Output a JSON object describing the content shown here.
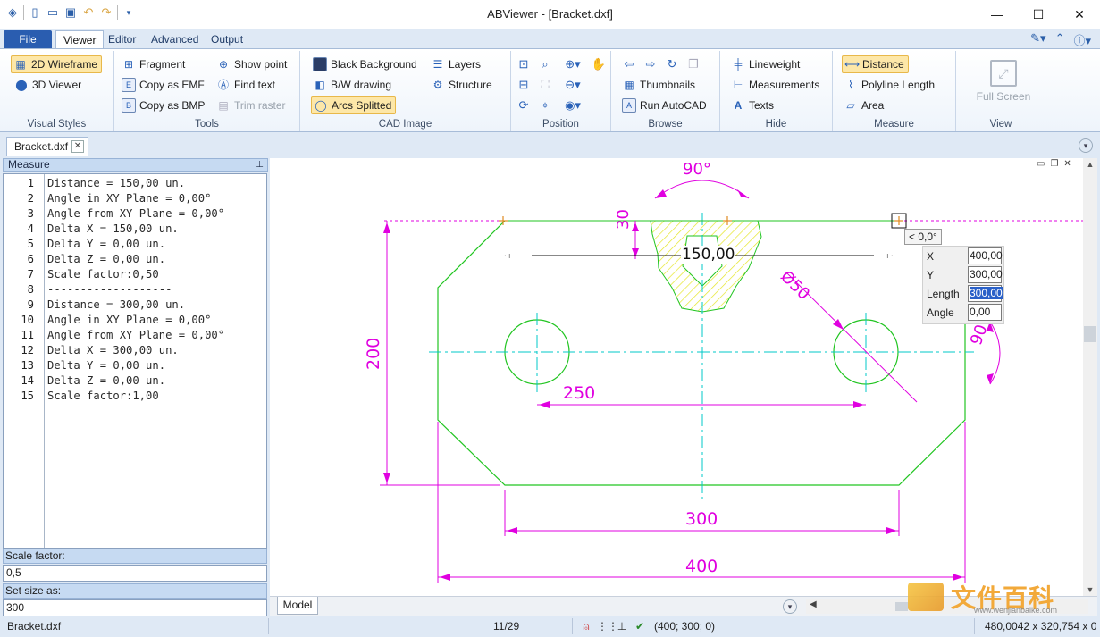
{
  "window": {
    "title": "ABViewer - [Bracket.dxf]",
    "minimize_icon": "minimize-icon",
    "maximize_icon": "maximize-icon",
    "close_icon": "close-icon"
  },
  "tabs": [
    "File",
    "Viewer",
    "Editor",
    "Advanced",
    "Output"
  ],
  "ribbon": {
    "visual_styles": {
      "label": "Visual Styles",
      "wireframe": "2D Wireframe",
      "viewer3d": "3D Viewer"
    },
    "tools": {
      "label": "Tools",
      "fragment": "Fragment",
      "copy_emf": "Copy as EMF",
      "copy_bmp": "Copy as BMP",
      "show_point": "Show point",
      "find_text": "Find text",
      "trim_raster": "Trim raster"
    },
    "cad_image": {
      "label": "CAD Image",
      "black_bg": "Black Background",
      "bw": "B/W drawing",
      "arcs": "Arcs Splitted",
      "layers": "Layers",
      "structure": "Structure"
    },
    "position": {
      "label": "Position"
    },
    "browse": {
      "label": "Browse",
      "thumbnails": "Thumbnails",
      "run_autocad": "Run AutoCAD"
    },
    "hide": {
      "label": "Hide",
      "lineweight": "Lineweight",
      "measurements": "Measurements",
      "texts": "Texts"
    },
    "measure": {
      "label": "Measure",
      "distance": "Distance",
      "polyline": "Polyline Length",
      "area": "Area"
    },
    "view": {
      "label": "View",
      "fullscreen": "Full Screen"
    }
  },
  "doc_tab": "Bracket.dxf",
  "panel": {
    "title": "Measure",
    "lines": [
      {
        "n": "1",
        "text": "Distance = 150,00 un."
      },
      {
        "n": "2",
        "text": "Angle in XY Plane = 0,00°"
      },
      {
        "n": "3",
        "text": "Angle from XY Plane = 0,00°"
      },
      {
        "n": "4",
        "text": "Delta X = 150,00 un."
      },
      {
        "n": "5",
        "text": "Delta Y = 0,00 un."
      },
      {
        "n": "6",
        "text": "Delta Z = 0,00 un."
      },
      {
        "n": "7",
        "text": "Scale factor:0,50"
      },
      {
        "n": "8",
        "text": "-------------------"
      },
      {
        "n": "9",
        "text": "Distance = 300,00 un."
      },
      {
        "n": "10",
        "text": "Angle in XY Plane = 0,00°"
      },
      {
        "n": "11",
        "text": "Angle from XY Plane = 0,00°"
      },
      {
        "n": "12",
        "text": "Delta X = 300,00 un."
      },
      {
        "n": "13",
        "text": "Delta Y = 0,00 un."
      },
      {
        "n": "14",
        "text": "Delta Z = 0,00 un."
      },
      {
        "n": "15",
        "text": "Scale factor:1,00"
      }
    ],
    "scale_label": "Scale factor:",
    "scale_value": "0,5",
    "size_label": "Set size as:",
    "size_value": "300"
  },
  "drawing": {
    "dims": {
      "d90top": "90°",
      "d30": "30",
      "d150": "150,00",
      "d50": "Ø50",
      "d200": "200",
      "d250": "250",
      "d90right": "90°",
      "d300": "300",
      "d400": "400"
    },
    "angle_tip": "< 0,0°",
    "popup": {
      "x_label": "X",
      "x_value": "400,00",
      "y_label": "Y",
      "y_value": "300,00",
      "len_label": "Length",
      "len_value": "300,00",
      "angle_label": "Angle",
      "angle_value": "0,00"
    },
    "colors": {
      "magenta": "#e000e0",
      "green": "#22c522",
      "cyan": "#00c8c8",
      "hatch": "#e6e62a"
    }
  },
  "model_tab": "Model",
  "status": {
    "file": "Bracket.dxf",
    "page": "11/29",
    "coords": "(400; 300; 0)",
    "size": "480,0042 x 320,754 x 0"
  },
  "watermark": {
    "cn": "文件百科",
    "url": "www.wenjianbaike.com"
  }
}
